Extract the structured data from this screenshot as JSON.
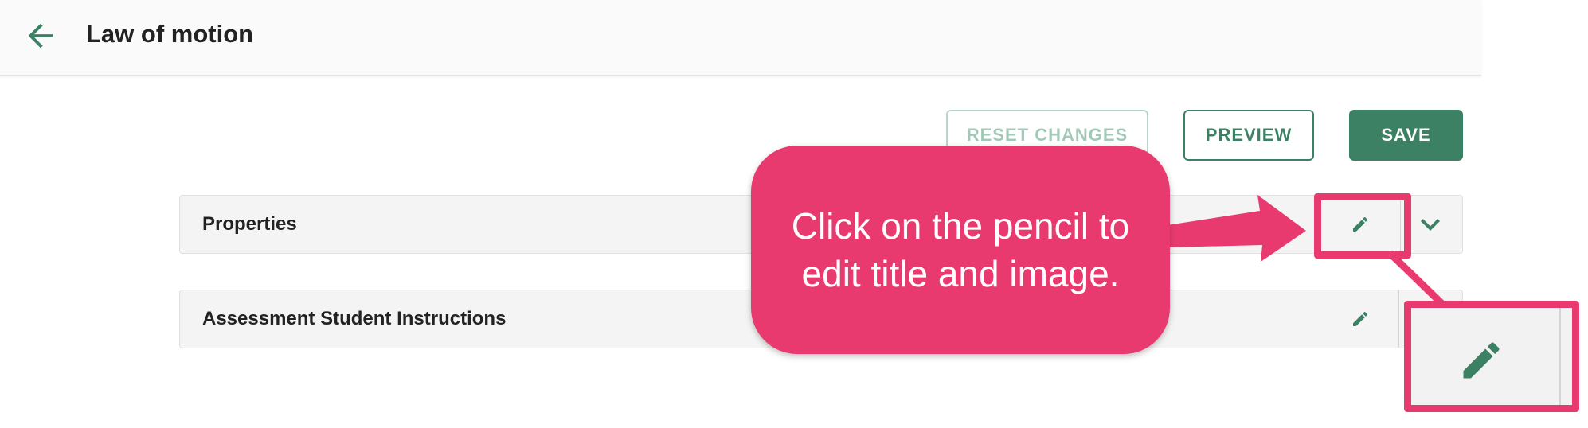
{
  "header": {
    "title": "Law of motion",
    "back_icon": "arrow-left-icon"
  },
  "actions": {
    "reset_label": "RESET CHANGES",
    "preview_label": "PREVIEW",
    "save_label": "SAVE"
  },
  "panels": [
    {
      "title": "Properties",
      "edit_icon": "pencil-icon",
      "expand_icon": "chevron-down-icon"
    },
    {
      "title": "Assessment Student Instructions",
      "edit_icon": "pencil-icon"
    }
  ],
  "annotation": {
    "callout_text": "Click on the pencil to\nedit title and image.",
    "color": "#e93a70"
  },
  "colors": {
    "brand_green": "#3d8165",
    "disabled_green": "#a3c8b7",
    "callout_pink": "#e93a70"
  }
}
